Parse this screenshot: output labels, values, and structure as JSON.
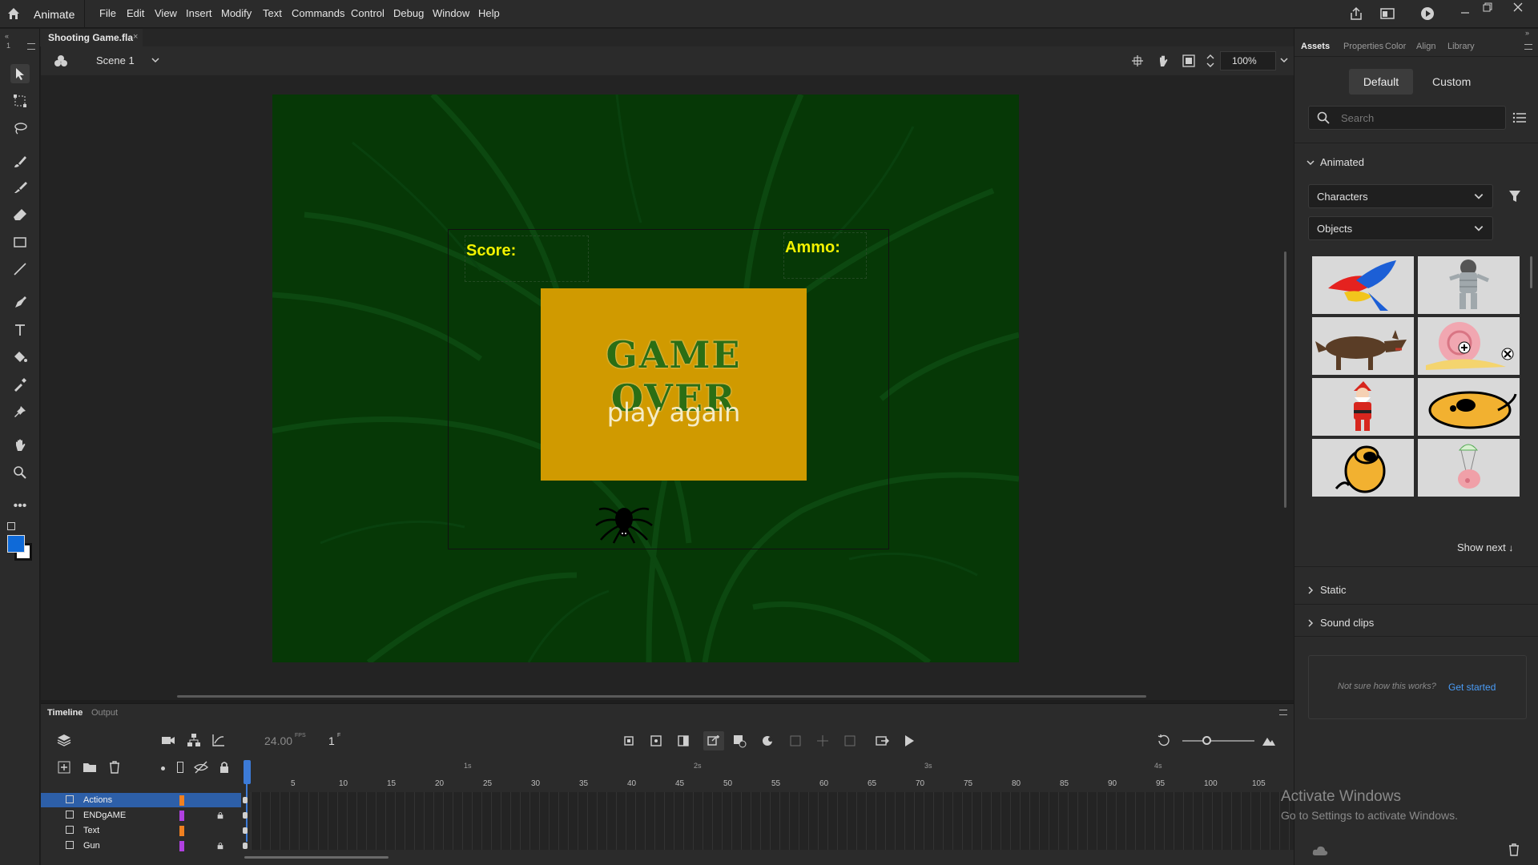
{
  "app": {
    "name": "Animate",
    "menu": [
      "File",
      "Edit",
      "View",
      "Insert",
      "Modify",
      "Text",
      "Commands",
      "Control",
      "Debug",
      "Window",
      "Help"
    ]
  },
  "document": {
    "tab_title": "Shooting Game.fla",
    "scene": "Scene 1",
    "zoom": "100%"
  },
  "stage": {
    "score_label": "Score:",
    "ammo_label": "Ammo:",
    "game_over": "GAME OVER",
    "play_again": "play again",
    "colors": {
      "background": "#0b3d0b",
      "panel": "#d09a00",
      "label": "#f2f200"
    }
  },
  "timeline": {
    "tabs": [
      "Timeline",
      "Output"
    ],
    "fps": "24.00",
    "fps_unit": "FPS",
    "current_frame": "1",
    "frame_unit": "F",
    "seconds": [
      "1s",
      "2s",
      "3s",
      "4s"
    ],
    "frame_numbers": [
      "5",
      "10",
      "15",
      "20",
      "25",
      "30",
      "35",
      "40",
      "45",
      "50",
      "55",
      "60",
      "65",
      "70",
      "75",
      "80",
      "85",
      "90",
      "95",
      "100",
      "105"
    ],
    "layers": [
      {
        "name": "Actions",
        "color": "#f08020",
        "selected": true,
        "locked": false
      },
      {
        "name": "ENDgAME",
        "color": "#b040e0",
        "selected": false,
        "locked": true
      },
      {
        "name": "Text",
        "color": "#f08020",
        "selected": false,
        "locked": false
      },
      {
        "name": "Gun",
        "color": "#b040e0",
        "selected": false,
        "locked": true
      }
    ]
  },
  "panel": {
    "tabs": [
      "Assets",
      "Properties",
      "Color",
      "Align",
      "Library"
    ],
    "toggle": [
      "Default",
      "Custom"
    ],
    "search_placeholder": "Search",
    "sections": {
      "animated": "Animated",
      "static": "Static",
      "sound": "Sound clips"
    },
    "filters": [
      "Characters",
      "Objects"
    ],
    "show_next": "Show next",
    "help_text": "Not sure how this works?",
    "help_link": "Get started",
    "thumbnails": [
      "parrot",
      "mummy",
      "wolf",
      "snail",
      "santa",
      "dog-lying",
      "dog-sitting",
      "pig-parachute"
    ]
  },
  "watermark": {
    "title": "Activate Windows",
    "subtitle": "Go to Settings to activate Windows."
  }
}
